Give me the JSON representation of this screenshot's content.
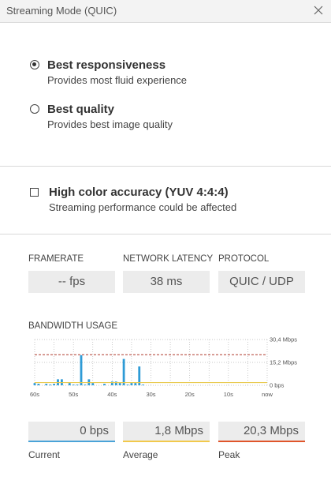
{
  "window": {
    "title": "Streaming Mode (QUIC)"
  },
  "mode_options": [
    {
      "title": "Best responsiveness",
      "subtitle": "Provides most fluid experience",
      "selected": true
    },
    {
      "title": "Best quality",
      "subtitle": "Provides best image quality",
      "selected": false
    }
  ],
  "color_option": {
    "title": "High color accuracy (YUV 4:4:4)",
    "subtitle": "Streaming performance could be affected",
    "checked": false
  },
  "stats": {
    "framerate": {
      "label": "FRAMERATE",
      "value": "-- fps"
    },
    "latency": {
      "label": "NETWORK LATENCY",
      "value": "38 ms"
    },
    "protocol": {
      "label": "PROTOCOL",
      "value": "QUIC / UDP"
    }
  },
  "bandwidth": {
    "label": "BANDWIDTH USAGE",
    "current": {
      "value": "0 bps",
      "caption": "Current",
      "color": "#4aa3d8"
    },
    "average": {
      "value": "1,8 Mbps",
      "caption": "Average",
      "color": "#f2c94c"
    },
    "peak": {
      "value": "20,3 Mbps",
      "caption": "Peak",
      "color": "#e0552b"
    }
  },
  "chart_data": {
    "type": "bar",
    "title": "BANDWIDTH USAGE",
    "x": [
      60,
      59,
      58,
      57,
      56,
      55,
      54,
      53,
      52,
      51,
      50,
      49,
      48,
      47,
      46,
      45,
      44,
      43,
      42,
      41,
      40,
      39,
      38,
      37,
      36,
      35,
      34,
      33,
      32,
      31,
      30,
      29,
      28,
      27,
      26,
      25,
      24,
      23,
      22,
      21,
      20,
      19,
      18,
      17,
      16,
      15,
      14,
      13,
      12,
      11,
      10,
      9,
      8,
      7,
      6,
      5,
      4,
      3,
      2,
      1,
      0
    ],
    "x_tick_labels": [
      "60s",
      "50s",
      "40s",
      "30s",
      "20s",
      "10s",
      "now"
    ],
    "x_ticks": [
      60,
      50,
      40,
      30,
      20,
      10,
      0
    ],
    "y_tick_labels": [
      "30,4 Mbps",
      "15,2 Mbps",
      "0 bps"
    ],
    "y_ticks": [
      30.4,
      15.2,
      0
    ],
    "ylim": [
      0,
      30.4
    ],
    "values": [
      1.5,
      1.0,
      0,
      1.0,
      0.5,
      1.0,
      4.0,
      4.0,
      0,
      1.5,
      0.5,
      0.5,
      20.0,
      0.5,
      4.0,
      1.5,
      0,
      0,
      1.0,
      0,
      2.5,
      2.5,
      1.5,
      17.5,
      0.5,
      1.5,
      1.5,
      12.5,
      0.5,
      0,
      0,
      0,
      0,
      0,
      0,
      0,
      0,
      0,
      0,
      0,
      0,
      0,
      0,
      0,
      0,
      0,
      0,
      0,
      0,
      0,
      0,
      0,
      0,
      0,
      0,
      0,
      0,
      0,
      0,
      0,
      0
    ],
    "bar_color": "#2e9bd6",
    "peak_line": 20.3,
    "peak_color": "#b03a2e",
    "average_line": 1.8,
    "average_color": "#e8c84a",
    "grid": true
  }
}
